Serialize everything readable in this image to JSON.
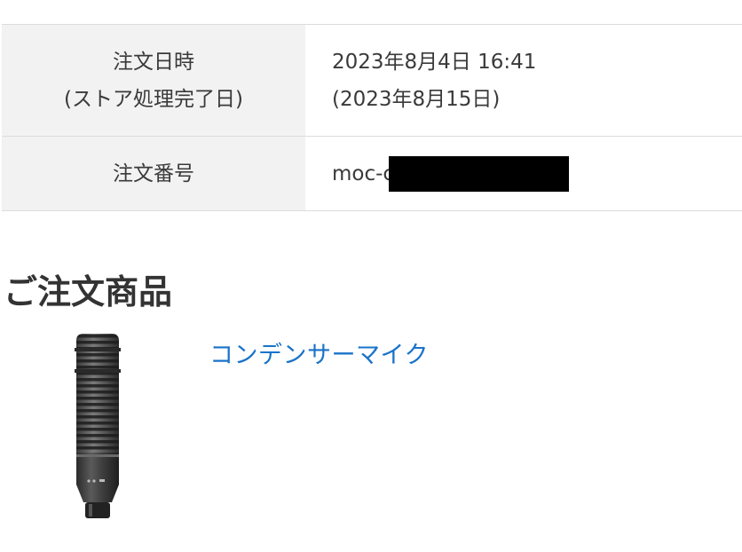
{
  "order_info": {
    "date_label_line1": "注文日時",
    "date_label_line2": "(ストア処理完了日)",
    "date_value_line1": "2023年8月4日 16:41",
    "date_value_line2": "(2023年8月15日)",
    "number_label": "注文番号",
    "number_value_visible": "moc-c"
  },
  "products_section": {
    "title": "ご注文商品",
    "items": [
      {
        "name": "コンデンサーマイク",
        "image_icon": "microphone-icon"
      }
    ]
  },
  "colors": {
    "label_background": "#f2f2f2",
    "border": "#dcdcdc",
    "link": "#1a73c9",
    "text": "#333333",
    "redaction": "#000000"
  }
}
